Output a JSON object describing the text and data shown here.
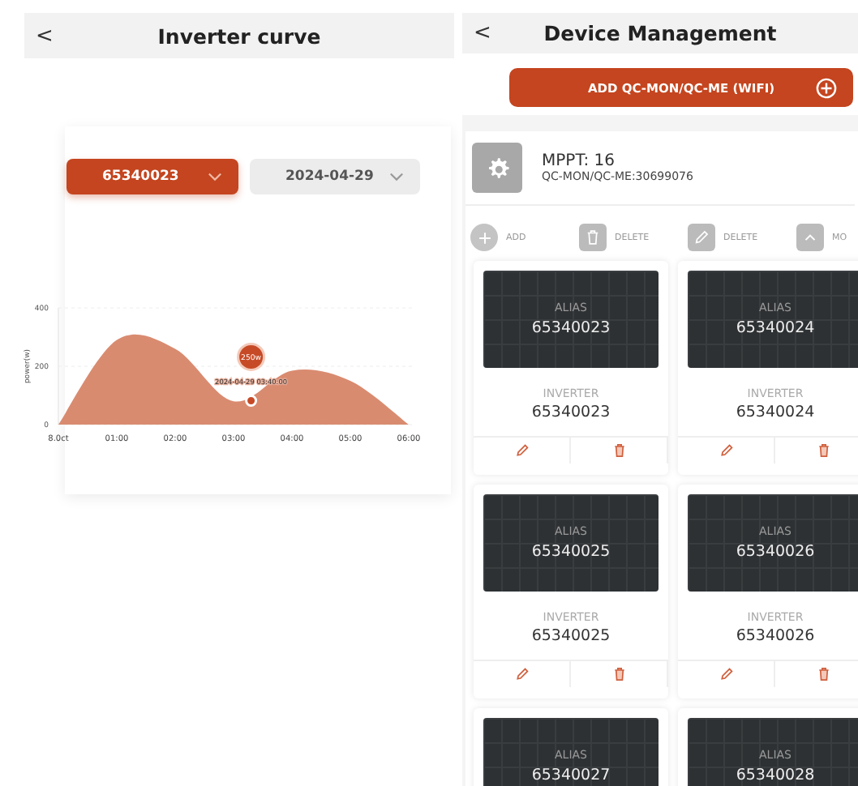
{
  "inverter_screen": {
    "title": "Inverter curve",
    "back": "<",
    "device_dropdown": {
      "value": "65340023"
    },
    "date_dropdown": {
      "value": "2024-04-29"
    },
    "chart_data": {
      "type": "area",
      "ylabel": "power(w)",
      "categories": [
        "8.0ct",
        "01:00",
        "02:00",
        "03:00",
        "04:00",
        "05:00",
        "06:00"
      ],
      "yticks": [
        0,
        200,
        400
      ],
      "ylim": [
        0,
        400
      ],
      "series": [
        {
          "color": "#d98b70",
          "values": [
            0,
            290,
            260,
            80,
            185,
            150,
            0
          ]
        }
      ]
    },
    "tooltip": {
      "value": "250w",
      "time": "2024-04-29 03:40:00"
    }
  },
  "device_screen": {
    "title": "Device Management",
    "back": "<",
    "add_button": "ADD QC-MON/QC-ME (WIFI)",
    "gateway": {
      "title": "MPPT: 16",
      "subtitle": "QC-MON/QC-ME:30699076"
    },
    "actions": [
      {
        "kind": "add",
        "label": "ADD"
      },
      {
        "kind": "trash",
        "label": "DELETE"
      },
      {
        "kind": "edit",
        "label": "DELETE"
      },
      {
        "kind": "up",
        "label": "MO"
      }
    ],
    "devices": [
      {
        "alias_label": "ALIAS",
        "alias": "65340023",
        "type_label": "INVERTER",
        "serial": "65340023"
      },
      {
        "alias_label": "ALIAS",
        "alias": "65340024",
        "type_label": "INVERTER",
        "serial": "65340024"
      },
      {
        "alias_label": "ALIAS",
        "alias": "65340025",
        "type_label": "INVERTER",
        "serial": "65340025"
      },
      {
        "alias_label": "ALIAS",
        "alias": "65340026",
        "type_label": "INVERTER",
        "serial": "65340026"
      },
      {
        "alias_label": "ALIAS",
        "alias": "65340027"
      },
      {
        "alias_label": "ALIAS",
        "alias": "65340028"
      }
    ]
  }
}
